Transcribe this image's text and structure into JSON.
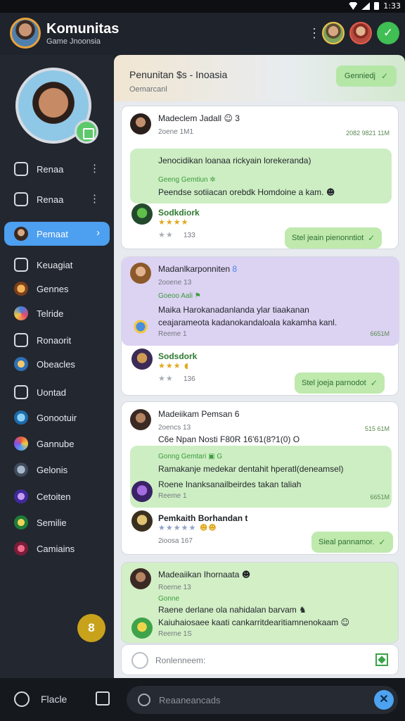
{
  "status": {
    "clock": "1:33"
  },
  "header": {
    "title": "Komunitas",
    "subtitle": "Game Jnoonsia"
  },
  "sidebar": {
    "items": [
      {
        "label": "Renaa"
      },
      {
        "label": "Renaa"
      },
      {
        "label": "Pemaat"
      },
      {
        "label": "Keuagiat"
      },
      {
        "label": "Gennes"
      },
      {
        "label": "Telride"
      },
      {
        "label": "Ronaorit"
      },
      {
        "label": "Obeacles"
      },
      {
        "label": "Uontad"
      },
      {
        "label": "Gonootuir"
      },
      {
        "label": "Gannube"
      },
      {
        "label": "Gelonis"
      },
      {
        "label": "Cetoiten"
      },
      {
        "label": "Semilie"
      },
      {
        "label": "Camiains"
      }
    ],
    "fab_label": "8"
  },
  "topcard": {
    "title": "Penunitan $s - Inoasia",
    "subtitle": "Oemarcanl",
    "button_label": "Genniedj"
  },
  "posts": [
    {
      "name": "Madeclem Jadall",
      "name_extra": "3",
      "sub": "2oene 1M1",
      "time": "2082 9821 11M",
      "body": "Jenocidikan loanaa rickyain lorekeranda)",
      "tag": "Geeng Gemtiun",
      "line": "Peendse sotiiacan orebdk Homdoine a kam.",
      "reply_name": "Sodkdiork",
      "count": "133",
      "button": "Stel jeain pienonntiot"
    },
    {
      "name": "Madanlkarponniten",
      "name_extra": "8",
      "sub": "2ooene 13",
      "tag": "Goeoo Aali",
      "line1": "Maika Harokanadanlanda ylar tiaakanan",
      "line2": "ceajarameota kadanokandaloala kakamha kanl.",
      "sub2": "Reeme 1",
      "time": "6651M",
      "reply_name": "Sodsdork",
      "count": "136",
      "button": "Stel joeja parnodot"
    },
    {
      "name": "Madeiikam Pemsan",
      "name_extra": "6",
      "sub": "2oencs 13",
      "time": "515 61M",
      "meta": "C6e Npan Nosti F80R 16'61(8?1(0)",
      "meta_extra": "O",
      "tag": "Gonng Gemtari",
      "tag_extra": "G",
      "line1": "Ramakanje medekar dentahit hperatl(deneamsel)",
      "line2": "Roene Inanksanailbeirdes takan taliah",
      "sub2": "Reeme 1",
      "time2": "6651M",
      "reply_name": "Pemkaith Borhandan",
      "reply_extra": "t",
      "count": "2ioosa 167",
      "button": "Sieal pannamor."
    },
    {
      "name": "Madeaiikan Ihornaata",
      "sub": "Roerne 13",
      "tag": "Gonne",
      "line1": "Raene derlane ola nahidalan barvam",
      "line2": "Kaiuhaiosaee kaati cankarritdearitiamnenokaam",
      "sub2": "Reerne 1S"
    }
  ],
  "compose": {
    "placeholder": "Ronlenneem:"
  },
  "bottombar": {
    "label": "Flacle",
    "search_placeholder": "Reaaneancads"
  }
}
